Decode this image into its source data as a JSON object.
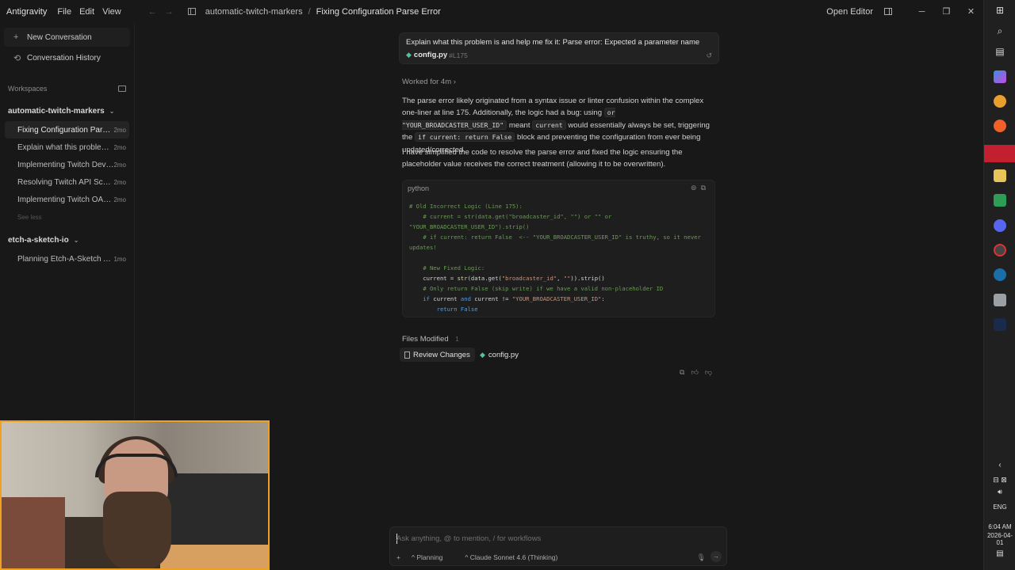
{
  "titlebar": {
    "app_name": "Antigravity",
    "menu": [
      "File",
      "Edit",
      "View"
    ],
    "breadcrumb": [
      "automatic-twitch-markers",
      "Fixing Configuration Parse Error"
    ],
    "open_editor": "Open Editor"
  },
  "sidebar": {
    "new_conversation": "New Conversation",
    "history": "Conversation History",
    "workspaces_label": "Workspaces",
    "workspaces": [
      {
        "name": "automatic-twitch-markers",
        "conversations": [
          {
            "title": "Fixing Configuration Parse Error",
            "age": "2mo"
          },
          {
            "title": "Explain what this problem is and help me fix it",
            "age": "2mo"
          },
          {
            "title": "Implementing Twitch Device Flow",
            "age": "2mo"
          },
          {
            "title": "Resolving Twitch API Scopes",
            "age": "2mo"
          },
          {
            "title": "Implementing Twitch OAuth",
            "age": "2mo"
          }
        ],
        "see_less": "See less"
      },
      {
        "name": "etch-a-sketch-io",
        "conversations": [
          {
            "title": "Planning Etch-A-Sketch App",
            "age": "1mo"
          }
        ]
      }
    ]
  },
  "chat": {
    "user_message": "Explain what this problem is and help me fix it: Parse error: Expected a parameter name",
    "attachment_file": "config.py",
    "attachment_line": "#L175",
    "worked_for": "Worked for 4m",
    "p1_a": "The parse error likely originated from a syntax issue or linter confusion within the complex one-liner at line 175. Additionally, the logic had a bug: using",
    "p1_code1": "or \"YOUR_BROADCASTER_USER_ID\"",
    "p1_b": "meant",
    "p1_code2": "current",
    "p1_c": "would essentially always be set, triggering the",
    "p1_code3": "if current: return False",
    "p1_d": "block and preventing the configuration from ever being updated/corrected.",
    "p2": "I have simplified the code to resolve the parse error and fixed the logic ensuring the placeholder value receives the correct treatment (allowing it to be overwritten).",
    "code_lang": "python",
    "files_modified_label": "Files Modified",
    "files_modified_count": "1",
    "review_changes": "Review Changes",
    "modified_file": "config.py"
  },
  "composer": {
    "placeholder": "Ask anything, @ to mention, / for workflows",
    "mode": "Planning",
    "model": "Claude Sonnet 4.6 (Thinking)"
  },
  "taskbar": {
    "language": "ENG",
    "time": "6:04 AM",
    "date": "2026-04-01"
  },
  "colors": {
    "accent_python": "#4fc3a1",
    "webcam_border": "#f0a020"
  }
}
